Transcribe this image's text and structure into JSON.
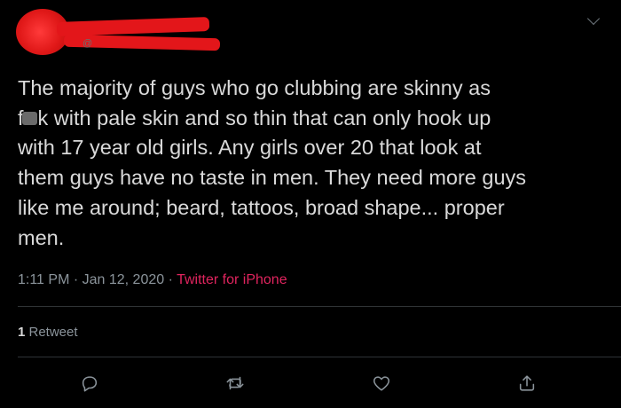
{
  "tweet": {
    "handle_partial": "@",
    "body_part1": "The majority of guys who go clubbing are skinny as\nf",
    "body_part2": "k with pale skin and so thin that can only hook up\nwith 17 year old girls. Any girls over 20 that look at\nthem guys have no taste in men. They need more guys\nlike me around; beard, tattoos, broad shape... proper\nmen.",
    "time": "1:11 PM",
    "sep1": " · ",
    "date": "Jan 12, 2020",
    "sep2": " · ",
    "app": "Twitter for iPhone",
    "retweet_count": "1",
    "retweet_label": " Retweet"
  },
  "colors": {
    "background": "#000000",
    "text": "#d9d9d9",
    "muted": "#8b949b",
    "app_link": "#e0245e",
    "redaction": "#e3161a"
  },
  "icons": {
    "menu": "chevron-down-icon",
    "reply": "reply-icon",
    "retweet": "retweet-icon",
    "like": "heart-icon",
    "share": "share-icon"
  }
}
